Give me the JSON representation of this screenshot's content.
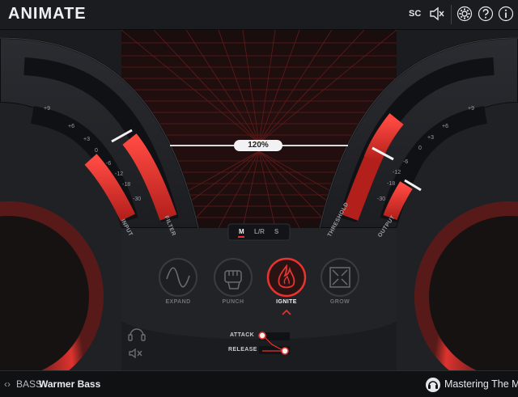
{
  "header": {
    "title": "ANIMATE",
    "sc_label": "SC"
  },
  "meters": {
    "left_scale": [
      "+9",
      "+6",
      "+3",
      "0",
      "-6",
      "-12",
      "-18",
      "-30"
    ],
    "right_scale": [
      "+9",
      "+6",
      "+3",
      "0",
      "-6",
      "-12",
      "-18",
      "-30"
    ],
    "input_label": "INPUT",
    "filter_label": "FILTER",
    "threshold_label": "THRESHOLD",
    "output_label": "OUTPUT"
  },
  "center": {
    "amount_value": "120%",
    "modes": [
      "M",
      "L/R",
      "S"
    ],
    "active_mode": "M"
  },
  "effects": {
    "expand": "EXPAND",
    "punch": "PUNCH",
    "ignite": "IGNITE",
    "grow": "GROW",
    "active": "IGNITE"
  },
  "envelope": {
    "attack_label": "ATTACK",
    "release_label": "RELEASE"
  },
  "footer": {
    "preset_category": "BASS",
    "preset_name": "Warmer Bass",
    "brand": "Mastering The Mix"
  },
  "colors": {
    "accent": "#e8342f",
    "background": "#17181b",
    "panel": "#26272b"
  },
  "icons": {
    "mute": "speaker-mute-icon",
    "settings": "gear-icon",
    "help": "question-icon",
    "info": "info-icon",
    "headphones": "headphones-icon",
    "prev": "chevron-left-icon",
    "next": "chevron-right-icon"
  }
}
